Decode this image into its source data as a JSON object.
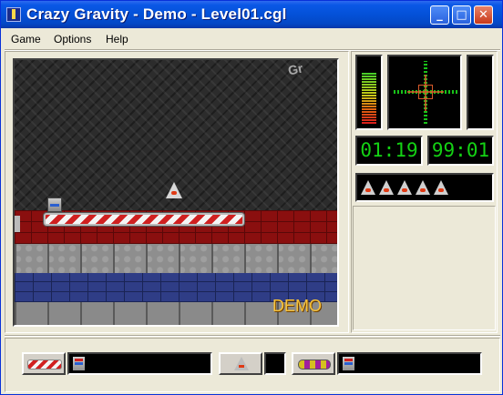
{
  "window": {
    "title": "Crazy Gravity - Demo - Level01.cgl",
    "minimize_glyph": "_",
    "maximize_glyph": "□",
    "close_glyph": "✕"
  },
  "menu": {
    "items": [
      "Game",
      "Options",
      "Help"
    ]
  },
  "game": {
    "watermark_text": "Gr",
    "demo_label": "DEMO"
  },
  "hud": {
    "time": "01:19",
    "fuel": "99:01",
    "lives": 5,
    "gauge_level": 0.82
  },
  "icons": {
    "app": "app-icon",
    "landing_pad": "landing-pad-icon",
    "ship": "ship-icon",
    "cargo": "cargo-icon",
    "fuel_canister": "fuel-canister-icon"
  },
  "colors": {
    "titlebar": "#0451D8",
    "lcd_text": "#14D114",
    "demo_text": "#F7C23A"
  }
}
